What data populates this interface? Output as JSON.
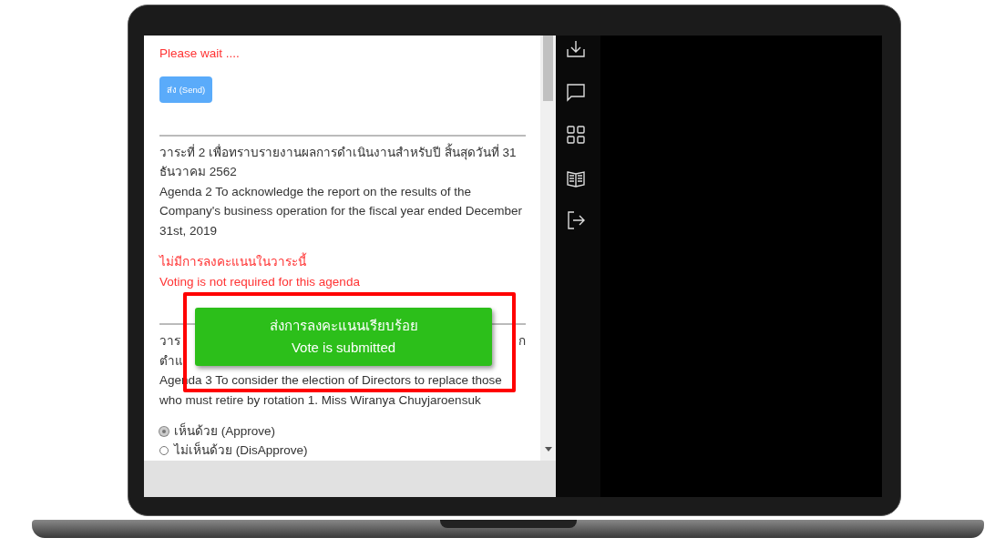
{
  "status_text": "Please wait ....",
  "send_button": "ส่ง (Send)",
  "agendas": [
    {
      "kind": "info",
      "lines_th": "วาระที่ 2 เพื่อทราบรายงานผลการดำเนินงานสำหรับปี สิ้นสุดวันที่ 31 ธันวาคม 2562",
      "text_en": "Agenda 2 To acknowledge the report on the results of the Company's business operation for the fiscal year ended December 31st, 2019",
      "notice_th": "ไม่มีการลงคะแนนในวาระนี้",
      "notice_en": "Voting is not required for this agenda"
    },
    {
      "kind": "vote",
      "visible_th": [
        {
          "left": "วาร",
          "right": "ก"
        },
        {
          "left": "ตำแ"
        }
      ],
      "text_en": "Agenda 3 To consider the election of Directors to replace those who must retire by rotation 1. Miss Wiranya Chuyjaroensuk",
      "options": [
        {
          "label": "เห็นด้วย (Approve)",
          "selected": true
        },
        {
          "label": "ไม่เห็นด้วย (DisApprove)",
          "selected": false
        }
      ]
    }
  ],
  "toast": {
    "line_th": "ส่งการลงคะแนนเรียบร้อย",
    "line_en": "Vote is submitted"
  }
}
